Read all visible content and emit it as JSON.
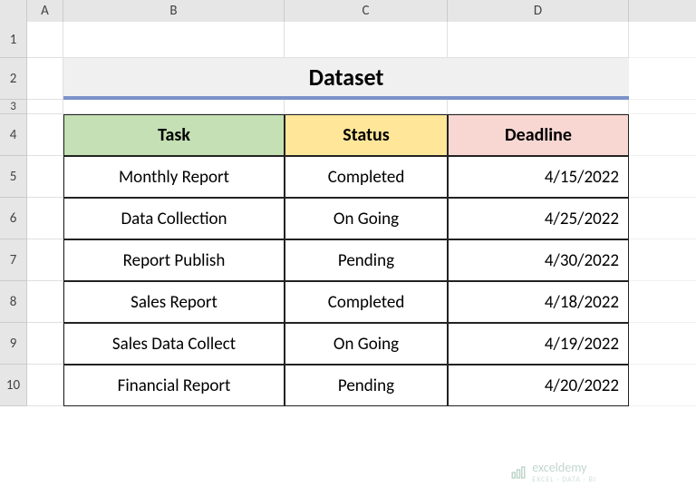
{
  "columns": {
    "A": "A",
    "B": "B",
    "C": "C",
    "D": "D"
  },
  "rows": {
    "r1": "1",
    "r2": "2",
    "r3": "3",
    "r4": "4",
    "r5": "5",
    "r6": "6",
    "r7": "7",
    "r8": "8",
    "r9": "9",
    "r10": "10"
  },
  "title": "Dataset",
  "headers": {
    "task": "Task",
    "status": "Status",
    "deadline": "Deadline"
  },
  "data": [
    {
      "task": "Monthly Report",
      "status": "Completed",
      "deadline": "4/15/2022"
    },
    {
      "task": "Data Collection",
      "status": "On Going",
      "deadline": "4/25/2022"
    },
    {
      "task": "Report Publish",
      "status": "Pending",
      "deadline": "4/30/2022"
    },
    {
      "task": "Sales Report",
      "status": "Completed",
      "deadline": "4/18/2022"
    },
    {
      "task": "Sales Data Collect",
      "status": "On Going",
      "deadline": "4/19/2022"
    },
    {
      "task": "Financial Report",
      "status": "Pending",
      "deadline": "4/20/2022"
    }
  ],
  "watermark": {
    "brand": "exceldemy",
    "tag": "EXCEL · DATA · BI"
  }
}
